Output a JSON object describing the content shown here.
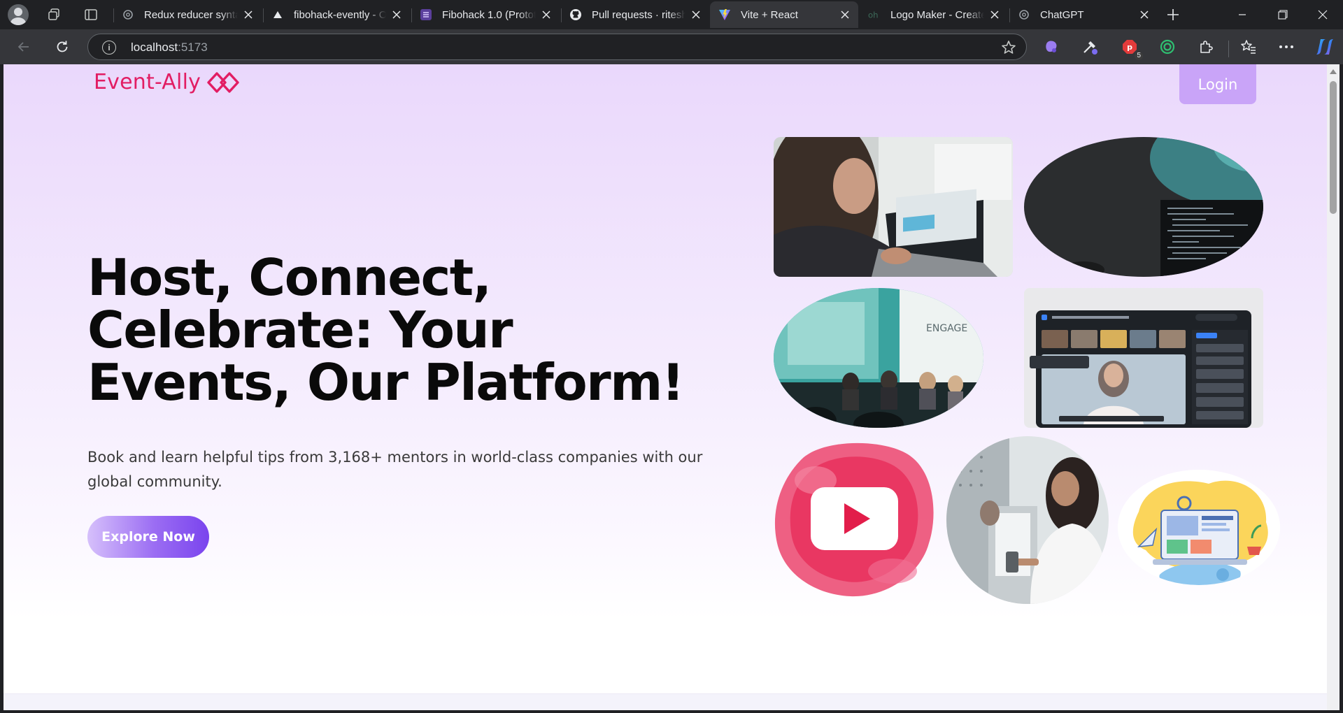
{
  "browser": {
    "tabs": [
      {
        "title": "Redux reducer synta",
        "favicon": "openai-icon",
        "active": false
      },
      {
        "title": "fibohack-evently - O",
        "favicon": "triangle-icon",
        "active": false
      },
      {
        "title": "Fibohack 1.0 (Protot",
        "favicon": "list-icon",
        "active": false
      },
      {
        "title": "Pull requests · ritesh",
        "favicon": "github-icon",
        "active": false
      },
      {
        "title": "Vite + React",
        "favicon": "vite-icon",
        "active": true
      },
      {
        "title": "Logo Maker - Create",
        "favicon": "oh-icon",
        "active": false
      },
      {
        "title": "ChatGPT",
        "favicon": "openai-icon",
        "active": false
      }
    ],
    "url_host": "localhost",
    "url_port": ":5173",
    "extension_badge": "5"
  },
  "page": {
    "logo_text": "Event-Ally",
    "login_label": "Login",
    "headline": "Host, Connect, Celebrate: Your Events, Our Platform!",
    "subtext": "Book and learn helpful tips from 3,168+ mentors in world-class companies with our global community.",
    "explore_label": "Explore Now",
    "conference_sign": "ENGAGE",
    "colors": {
      "brand": "#e21d63",
      "login_bg": "#c9a4f8",
      "explore_gradient_end": "#7a44ee",
      "page_gradient_top": "#ead8fc"
    }
  }
}
